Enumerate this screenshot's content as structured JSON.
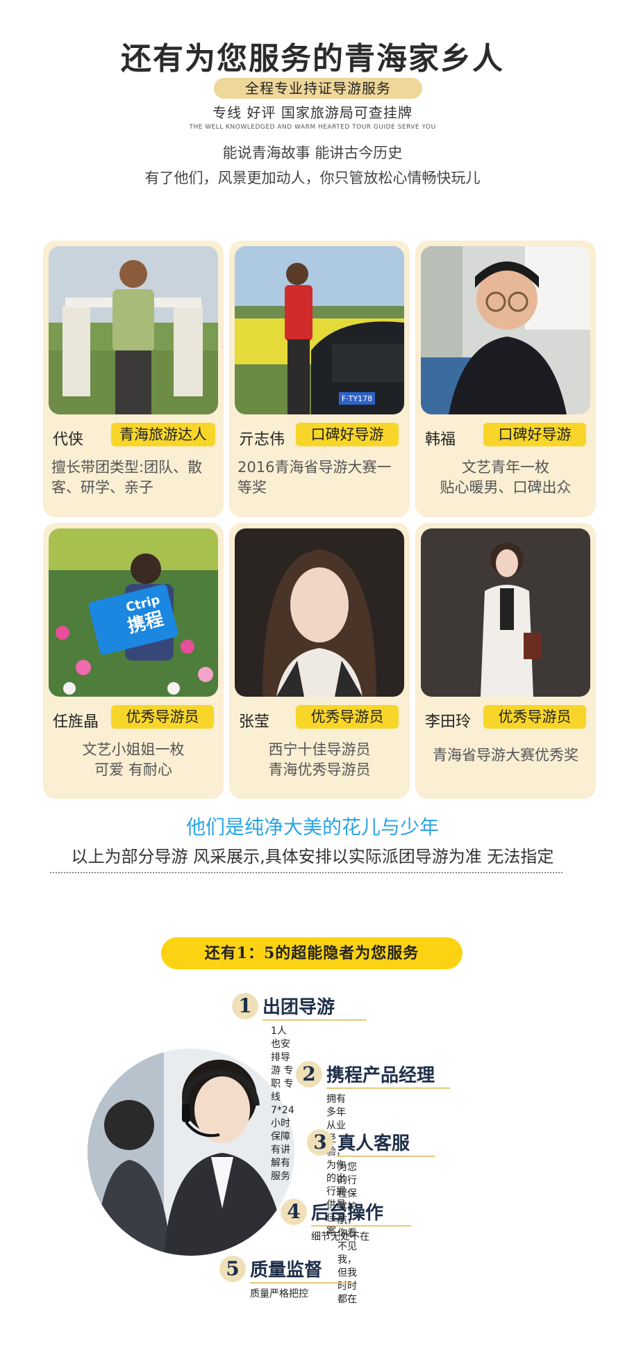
{
  "header": {
    "title": "还有为您服务的青海家乡人",
    "banner": "全程专业持证导游服务",
    "subline": "专线 好评  国家旅游局可查挂牌",
    "english": "THE WELL KNOWLEDGED AND WARM HEARTED TOUR GUIDE SERVE YOU",
    "slogan1": "能说青海故事  能讲古今历史",
    "slogan2": "有了他们，风景更加动人，你只管放松心情畅快玩儿"
  },
  "guides": [
    {
      "name": "代侠",
      "tag": "青海旅游达人",
      "desc": "擅长带团类型:团队、散客、研学、亲子"
    },
    {
      "name": "亓志伟",
      "tag": "口碑好导游",
      "desc": "2016青海省导游大赛一等奖"
    },
    {
      "name": "韩福",
      "tag": "口碑好导游",
      "desc": "文艺青年一枚\n贴心暖男、口碑出众"
    },
    {
      "name": "任旌晶",
      "tag": "优秀导游员",
      "desc": "文艺小姐姐一枚\n可爱 有耐心"
    },
    {
      "name": "张莹",
      "tag": "优秀导游员",
      "desc": "西宁十佳导游员\n青海优秀导游员"
    },
    {
      "name": "李田玲",
      "tag": "优秀导游员",
      "desc": "青海省导游大赛优秀奖"
    }
  ],
  "photo_labels": {
    "plate": "F·TY178",
    "ctrip_en": "Ctrip",
    "ctrip_cn": "携程"
  },
  "footer_note": {
    "blue": "他们是纯净大美的花儿与少年",
    "note": "以上为部分导游  风采展示,具体安排以实际派团导游为准 无法指定"
  },
  "service": {
    "pill": "还有1：5的超能隐者为您服务",
    "features": [
      {
        "num": "1",
        "title": "出团导游",
        "desc": "1人也安排导游  专职  专线  7*24小时保障\n有讲解有服务"
      },
      {
        "num": "2",
        "title": "携程产品经理",
        "desc": "拥有多年从业经验，为你的出行提\n供最佳方案"
      },
      {
        "num": "3",
        "title": "真人客服",
        "desc": "为您的行程保驾护航，你看不见我，\n但我时时都在"
      },
      {
        "num": "4",
        "title": "后台操作",
        "desc": "细节无处不在"
      },
      {
        "num": "5",
        "title": "质量监督",
        "desc": "质量严格把控"
      }
    ]
  },
  "colors": {
    "tag_yellow": "#f8d629",
    "card_bg": "#faeed3",
    "blue_text": "#2aa3e6",
    "pill_yellow": "#fbd313",
    "feature_title": "#1e2f4a"
  }
}
